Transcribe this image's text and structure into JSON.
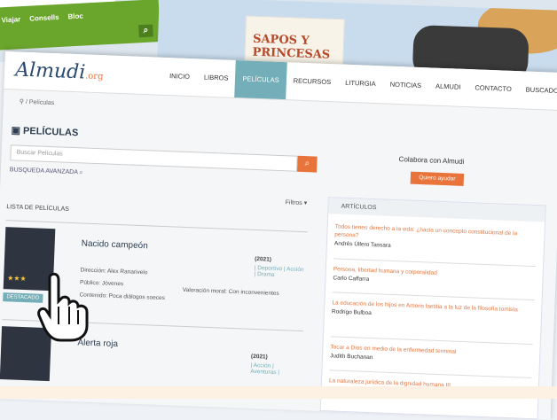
{
  "green_menu": [
    "Viajar",
    "Consells",
    "Bloc"
  ],
  "banner_book": "SAPOS Y PRINCESAS",
  "logo": {
    "name": "Almudi",
    "tld": ".org"
  },
  "nav": [
    "INICIO",
    "LIBROS",
    "PELÍCULAS",
    "RECURSOS",
    "LITURGIA",
    "NOTICIAS",
    "ALMUDI",
    "CONTACTO",
    "BUSCADOR"
  ],
  "active_nav": "PELÍCULAS",
  "breadcrumb": "Películas",
  "title": "PELÍCULAS",
  "search": {
    "placeholder": "Buscar Películas"
  },
  "advanced": "BUSQUEDA AVANZADA",
  "filtros": "Filtros",
  "list_title": "LISTA DE PELÍCULAS",
  "movies": [
    {
      "title": "Nacido campeón",
      "year": "(2021)",
      "genres": "| Deportivo | Acción | Drama",
      "direccion": "Dirección: Alex Ranarivelo",
      "publico": "Público: Jóvenes",
      "contenido": "Contenido: Poca diálogos soeces",
      "valoracion": "Valoración moral: Con inconvenientes",
      "badge": "DESTACADO",
      "stars": "★★★"
    },
    {
      "title": "Alerta roja",
      "year": "(2021)",
      "genres": "| Acción | Aventuras |"
    }
  ],
  "collab": {
    "text": "Colabora con Almudi",
    "button": "Quiero ayudar"
  },
  "articles_header": "ARTÍCULOS",
  "articles": [
    {
      "title": "Todos tienen derecho a la vida: ¿hacia un concepto constitucional de la persona?",
      "author": "Andrés Úllero Tassara"
    },
    {
      "title": "Persona, libertad humana y corporalidad",
      "author": "Carlo Caffarra"
    },
    {
      "title": "La educación de los hijos en Amoris laetitia a la luz de la filosofía tomista",
      "author": "Rodrigo Bulboa"
    },
    {
      "title": "Tocar a Dios en medio de la enfermedad terminal",
      "author": "Judith Buchanan"
    },
    {
      "title": "La naturaleza jurídica de la dignidad humana III",
      "author": ""
    }
  ],
  "colors": {
    "accent": "#e8743b",
    "teal": "#74aeb8",
    "navy": "#2a4a6e",
    "green": "#6aa52c"
  }
}
